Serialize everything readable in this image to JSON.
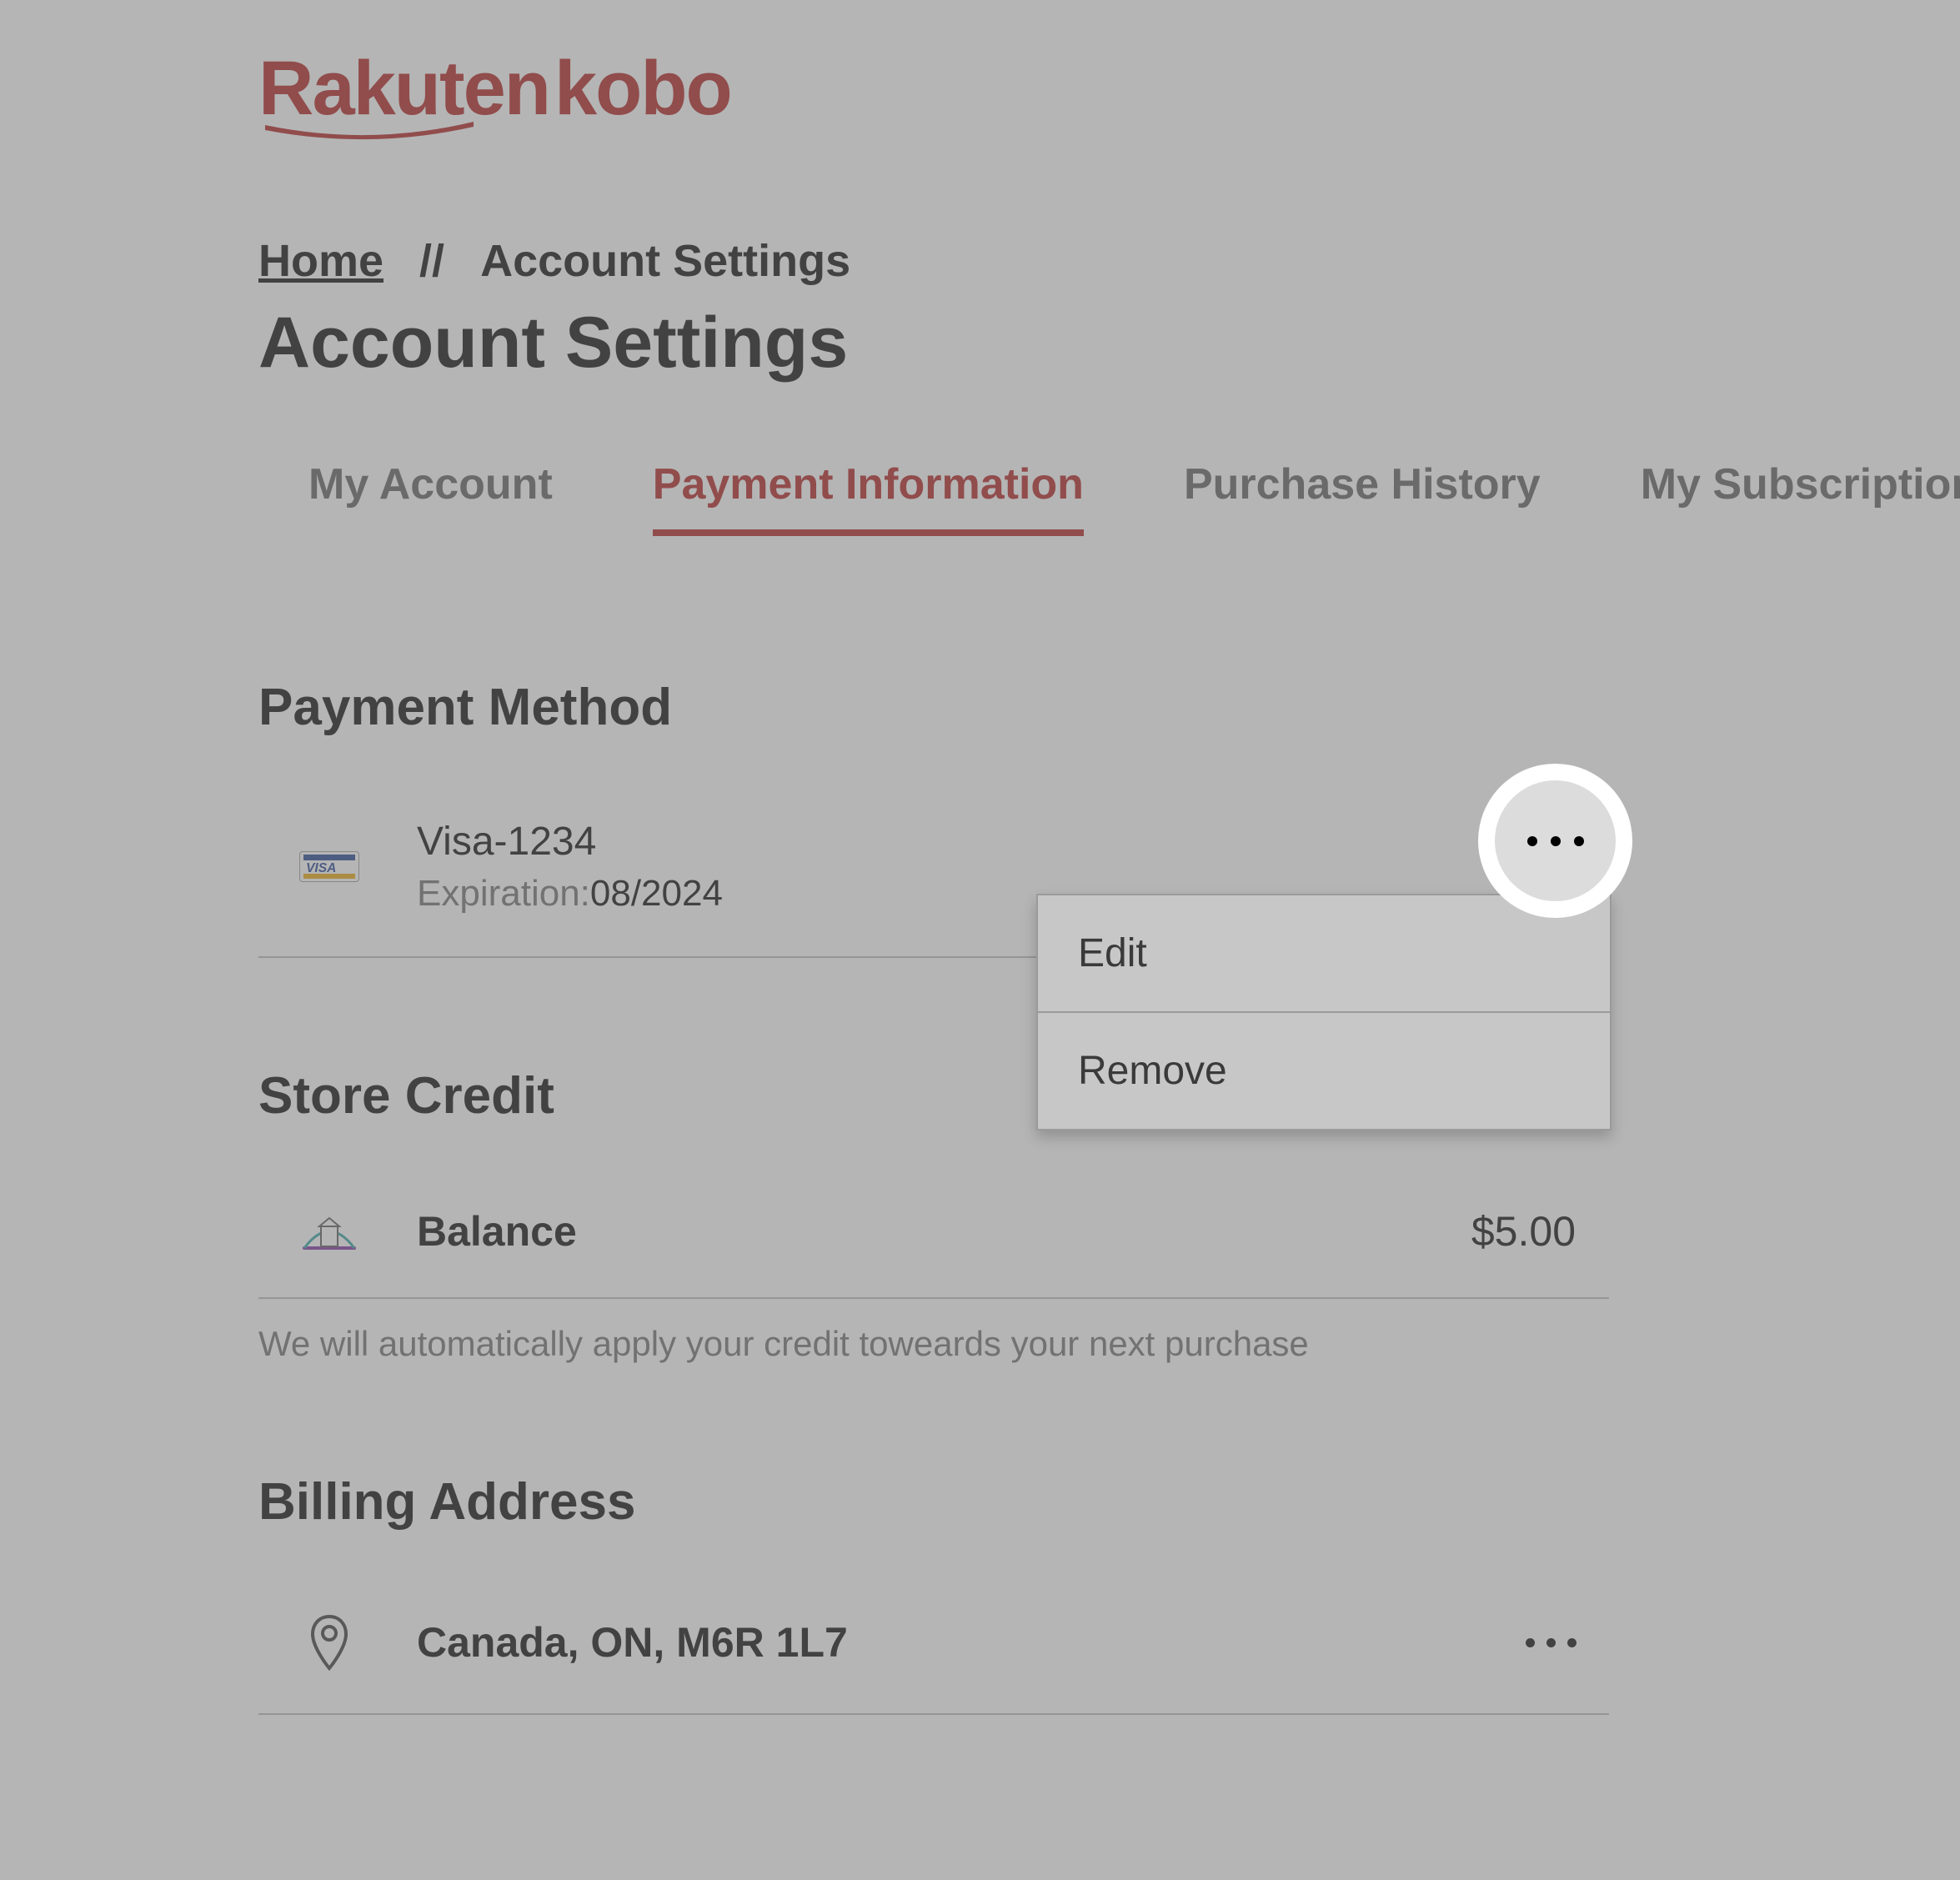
{
  "brand": {
    "primary": "Rakuten",
    "secondary": "kobo"
  },
  "breadcrumb": {
    "home": "Home",
    "sep": "//",
    "current": "Account Settings"
  },
  "page_title": "Account Settings",
  "tabs": [
    {
      "label": "My Account",
      "active": false
    },
    {
      "label": "Payment Information",
      "active": true
    },
    {
      "label": "Purchase History",
      "active": false
    },
    {
      "label": "My Subscriptions",
      "active": false
    }
  ],
  "payment_method": {
    "heading": "Payment Method",
    "card_brand": "Visa",
    "card_sep": "-",
    "card_last4": "1234",
    "exp_label": "Expiration:",
    "exp_value": "08/2024"
  },
  "store_credit": {
    "heading": "Store Credit",
    "balance_label": "Balance",
    "balance_value": "$5.00",
    "note": "We will automatically apply your credit toweards your next purchase"
  },
  "billing_address": {
    "heading": "Billing Address",
    "address": "Canada, ON, M6R 1L7"
  },
  "menu": {
    "edit": "Edit",
    "remove": "Remove"
  },
  "colors": {
    "brand": "#b01818",
    "muted": "#6a6a6a"
  }
}
